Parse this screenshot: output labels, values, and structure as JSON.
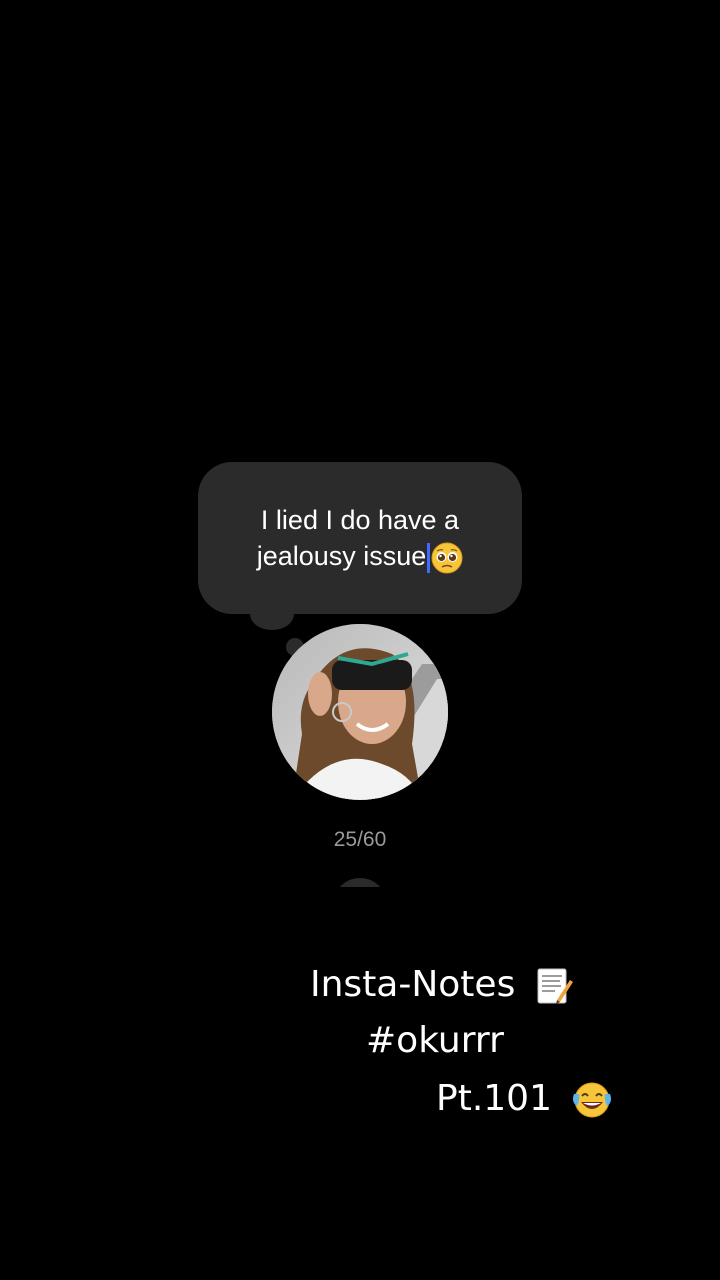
{
  "note": {
    "line1": "I lied I do have a",
    "line2": "jealousy issue",
    "emoji_icon": "pleading-face-icon"
  },
  "counter": "25/60",
  "caption": {
    "line1": "Insta-Notes",
    "line1_icon": "memo-icon",
    "line2": "#okurrr",
    "line3": "Pt.101",
    "line3_icon": "laughing-tears-icon"
  },
  "colors": {
    "background": "#000000",
    "bubble": "#2b2b2b",
    "caret": "#3f6cff",
    "counter": "#9a9a9a"
  }
}
